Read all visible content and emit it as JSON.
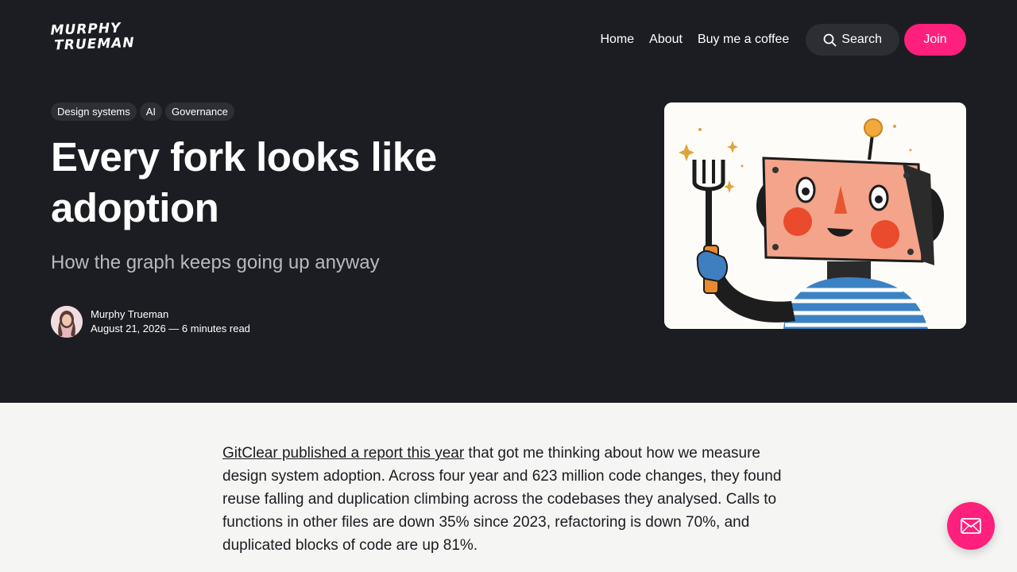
{
  "brand": {
    "line1": "MURPHY",
    "line2": "TRUEMAN"
  },
  "nav": {
    "home": "Home",
    "about": "About",
    "coffee": "Buy me a coffee",
    "search": "Search",
    "join": "Join"
  },
  "post": {
    "tags": [
      "Design systems",
      "AI",
      "Governance"
    ],
    "title": "Every fork looks like adoption",
    "subtitle": "How the graph keeps going up anyway",
    "author": "Murphy Trueman",
    "meta": "August 21, 2026 — 6 minutes read"
  },
  "article": {
    "link_text": "GitClear published a report this year",
    "body": " that got me thinking about how we measure design system adoption. Across four year and 623 million code changes, they found reuse falling and duplication climbing across the codebases they analysed. Calls to functions in other files are down 35% since 2023, refactoring is down 70%, and duplicated blocks of code are up 81%."
  },
  "colors": {
    "hero_bg": "#1c1d22",
    "accent": "#ff1f7c",
    "page_bg": "#f5f5f3"
  },
  "icons": {
    "search": "search-icon",
    "mail": "mail-icon"
  }
}
